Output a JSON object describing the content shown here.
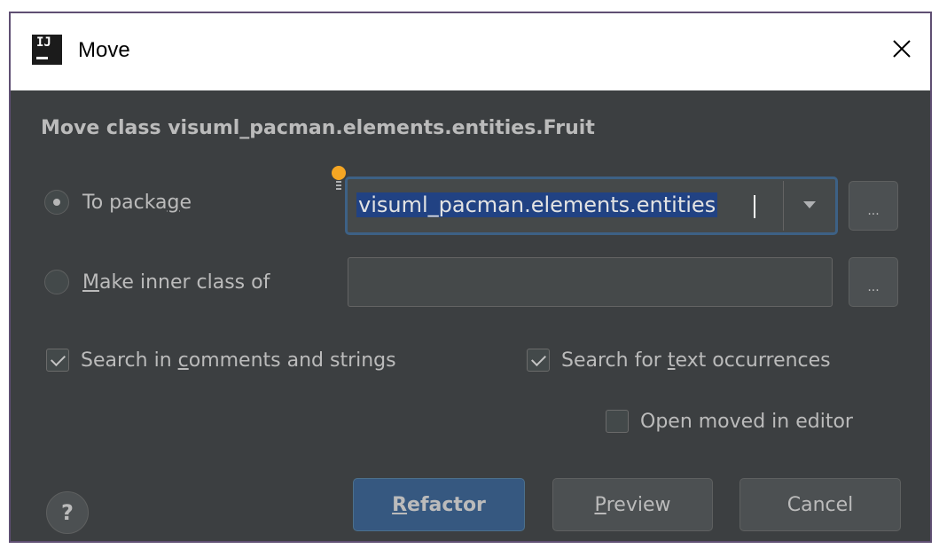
{
  "window": {
    "title": "Move",
    "app_icon_text": "IJ"
  },
  "dialog": {
    "heading": "Move class visuml_pacman.elements.entities.Fruit",
    "to_package": {
      "label_pre": "To packa",
      "label_mnemonic": "g",
      "label_post": "e",
      "selected": true,
      "value": "visuml_pacman.elements.entities"
    },
    "inner_class": {
      "label_mnemonic": "M",
      "label_post": "ake inner class of",
      "selected": false,
      "value": ""
    },
    "browse_label": "...",
    "search_comments": {
      "label_pre": "Search in ",
      "label_mnemonic": "c",
      "label_post": "omments and strings",
      "checked": true
    },
    "search_text": {
      "label_pre": "Search for ",
      "label_mnemonic": "t",
      "label_post": "ext occurrences",
      "checked": true
    },
    "open_in_editor": {
      "label": "Open moved in editor",
      "checked": false
    }
  },
  "buttons": {
    "help": "?",
    "refactor_mnemonic": "R",
    "refactor_rest": "efactor",
    "preview_mnemonic": "P",
    "preview_rest": "review",
    "cancel": "Cancel"
  },
  "colors": {
    "background": "#3c3f41",
    "accent": "#365880",
    "selection": "#214283",
    "bulb": "#f5a623"
  }
}
